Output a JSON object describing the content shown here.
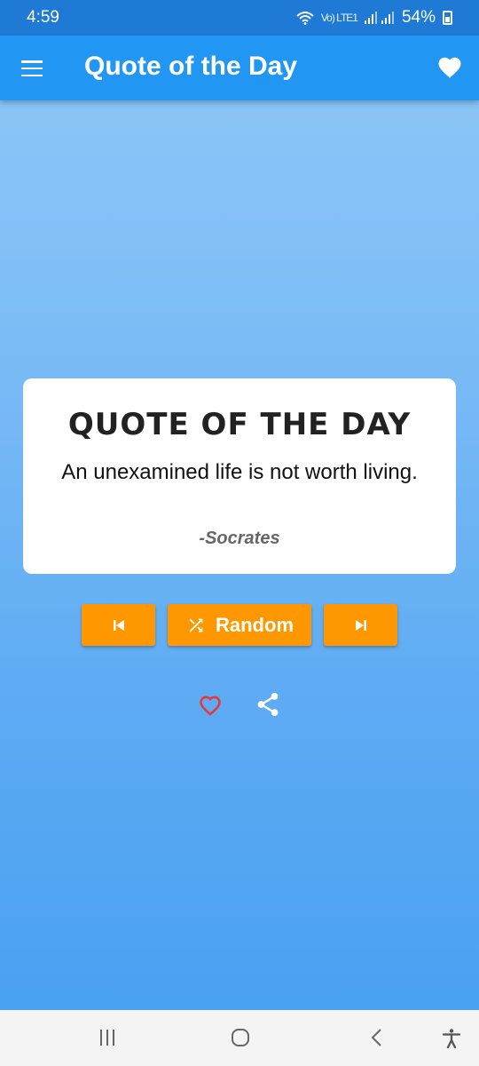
{
  "status_bar": {
    "time": "4:59",
    "network": "Vo) LTE1",
    "battery": "54%"
  },
  "app_bar": {
    "title": "Quote of the Day",
    "menu_icon": "hamburger-menu-icon",
    "favorites_icon": "heart-filled-icon"
  },
  "card": {
    "heading": "QUOTE OF THE DAY",
    "quote": "An unexamined life is not worth living.",
    "author": "-Socrates"
  },
  "controls": {
    "previous_icon": "skip-previous-icon",
    "random_label": "Random",
    "random_icon": "shuffle-icon",
    "next_icon": "skip-next-icon",
    "like_icon": "heart-outline-icon",
    "share_icon": "share-icon"
  },
  "colors": {
    "app_bar": "#2196f3",
    "status_bar": "#1f7ad6",
    "button": "#ff9800",
    "heart_outline": "#e53935"
  },
  "nav_bar": {
    "items": [
      "recent-apps-icon",
      "home-icon",
      "back-icon",
      "accessibility-icon"
    ]
  }
}
